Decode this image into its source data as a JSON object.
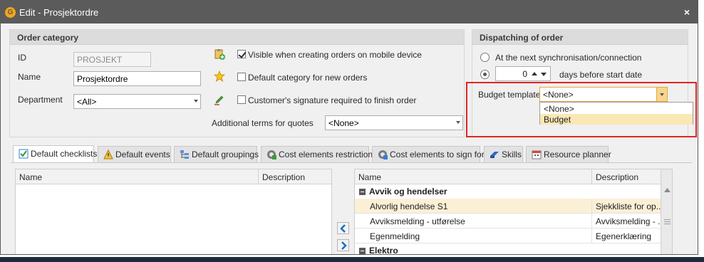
{
  "window": {
    "title": "Edit - Prosjektordre",
    "close_symbol": "×",
    "app_icon_symbol": "G"
  },
  "order_category": {
    "header": "Order category",
    "id_label": "ID",
    "id_value": "PROSJEKT",
    "name_label": "Name",
    "name_value": "Prosjektordre",
    "department_label": "Department",
    "department_value": "<All>",
    "visible_mobile_label": "Visible when creating orders on mobile device",
    "visible_mobile_checked": true,
    "default_category_label": "Default category for new orders",
    "default_category_checked": false,
    "signature_label": "Customer's signature required to finish order",
    "signature_checked": false,
    "additional_terms_label": "Additional terms for quotes",
    "additional_terms_value": "<None>"
  },
  "dispatching": {
    "header": "Dispatching of order",
    "option_sync_label": "At the next synchronisation/connection",
    "option_days_value": "0",
    "option_days_label": "days before start date",
    "selected_option": "days",
    "budget_template_label": "Budget template",
    "budget_template_value": "<None>",
    "budget_options": [
      "<None>",
      "Budget"
    ],
    "budget_highlighted_option": "Budget"
  },
  "tabs": [
    {
      "label": "Default checklists",
      "icon": "checklist-icon",
      "active": true
    },
    {
      "label": "Default events",
      "icon": "events-icon",
      "active": false
    },
    {
      "label": "Default groupings",
      "icon": "groupings-icon",
      "active": false
    },
    {
      "label": "Cost elements restriction",
      "icon": "cost-restriction-icon",
      "active": false
    },
    {
      "label": "Cost elements to sign for",
      "icon": "cost-sign-icon",
      "active": false
    },
    {
      "label": "Skills",
      "icon": "skills-icon",
      "active": false
    },
    {
      "label": "Resource planner",
      "icon": "calendar-icon",
      "active": false
    }
  ],
  "left_grid": {
    "columns": [
      "Name",
      "Description"
    ],
    "rows": []
  },
  "right_grid": {
    "columns": [
      "Name",
      "Description"
    ],
    "groups": [
      {
        "name": "Avvik og hendelser",
        "rows": [
          {
            "name": "Alvorlig hendelse S1",
            "description": "Sjekkliste for op...",
            "selected": true
          },
          {
            "name": "Avviksmelding - utførelse",
            "description": "Avviksmelding - ...",
            "selected": false
          },
          {
            "name": "Egenmelding",
            "description": "Egenerklæring",
            "selected": false
          }
        ]
      },
      {
        "name": "Elektro",
        "rows": []
      }
    ]
  },
  "colors": {
    "titlebar": "#5b5b5b",
    "highlight_box": "#e02424",
    "selected_row": "#fbf0d6",
    "arrow_buttons": "#1a6fc4"
  }
}
